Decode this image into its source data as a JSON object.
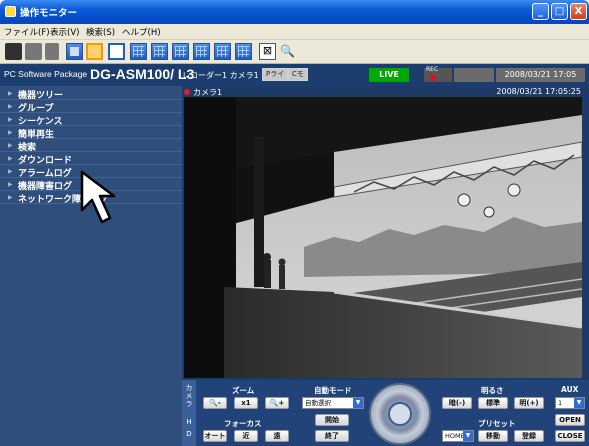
{
  "window": {
    "title": "操作モニター",
    "buttons": {
      "minimize": "_",
      "maximize": "□",
      "close": "X"
    }
  },
  "menu": {
    "items": [
      "ファイル(F)",
      "表示(V)",
      "検索(S)",
      "ヘルプ(H)"
    ]
  },
  "toolbar": {
    "icons": [
      "camera-icon",
      "print-icon",
      "export-icon",
      "layout-1-icon",
      "layout-4-icon",
      "layout-single-icon",
      "layout-grid-icon",
      "layout-grid-icon",
      "layout-grid-icon",
      "layout-grid-icon",
      "layout-grid-icon",
      "layout-grid-icon",
      "close-layout-icon",
      "zoom-icon"
    ]
  },
  "header": {
    "package_label": "PC Software Package",
    "model": "DG-ASM100/ L3",
    "recorder_camera": "レコーダー1 カメラ1",
    "btn_a": "Pライ",
    "btn_b": "Cモ",
    "live": "LIVE",
    "rec": "REC",
    "datetime": "2008/03/21 17:05"
  },
  "sidebar": {
    "items": [
      {
        "label": "機器ツリー"
      },
      {
        "label": "グループ"
      },
      {
        "label": "シーケンス"
      },
      {
        "label": "簡単再生"
      },
      {
        "label": "検索"
      },
      {
        "label": "ダウンロード"
      },
      {
        "label": "アラームログ"
      },
      {
        "label": "機器障害ログ"
      },
      {
        "label": "ネットワーク障害ログ"
      }
    ]
  },
  "camera": {
    "name": "カメラ1",
    "timestamp": "2008/03/21 17:05:25"
  },
  "controls": {
    "camera_label": "カメラ",
    "side_letters": [
      "H",
      "D"
    ],
    "zoom": {
      "label": "ズーム",
      "out": "-",
      "x1": "x1",
      "in": "+"
    },
    "focus": {
      "label": "フォーカス",
      "auto": "オート",
      "near": "近",
      "far": "遠"
    },
    "auto_mode": {
      "label": "自動モード",
      "select": "自動選択",
      "start": "開始",
      "stop": "終了"
    },
    "brightness": {
      "label": "明るさ",
      "dark": "暗(-)",
      "std": "標準",
      "bright": "明(+)"
    },
    "preset": {
      "label": "プリセット",
      "select": "HOME",
      "move": "移動",
      "register": "登録"
    },
    "aux": {
      "label": "AUX",
      "select": "1",
      "open": "OPEN",
      "close": "CLOSE"
    }
  }
}
